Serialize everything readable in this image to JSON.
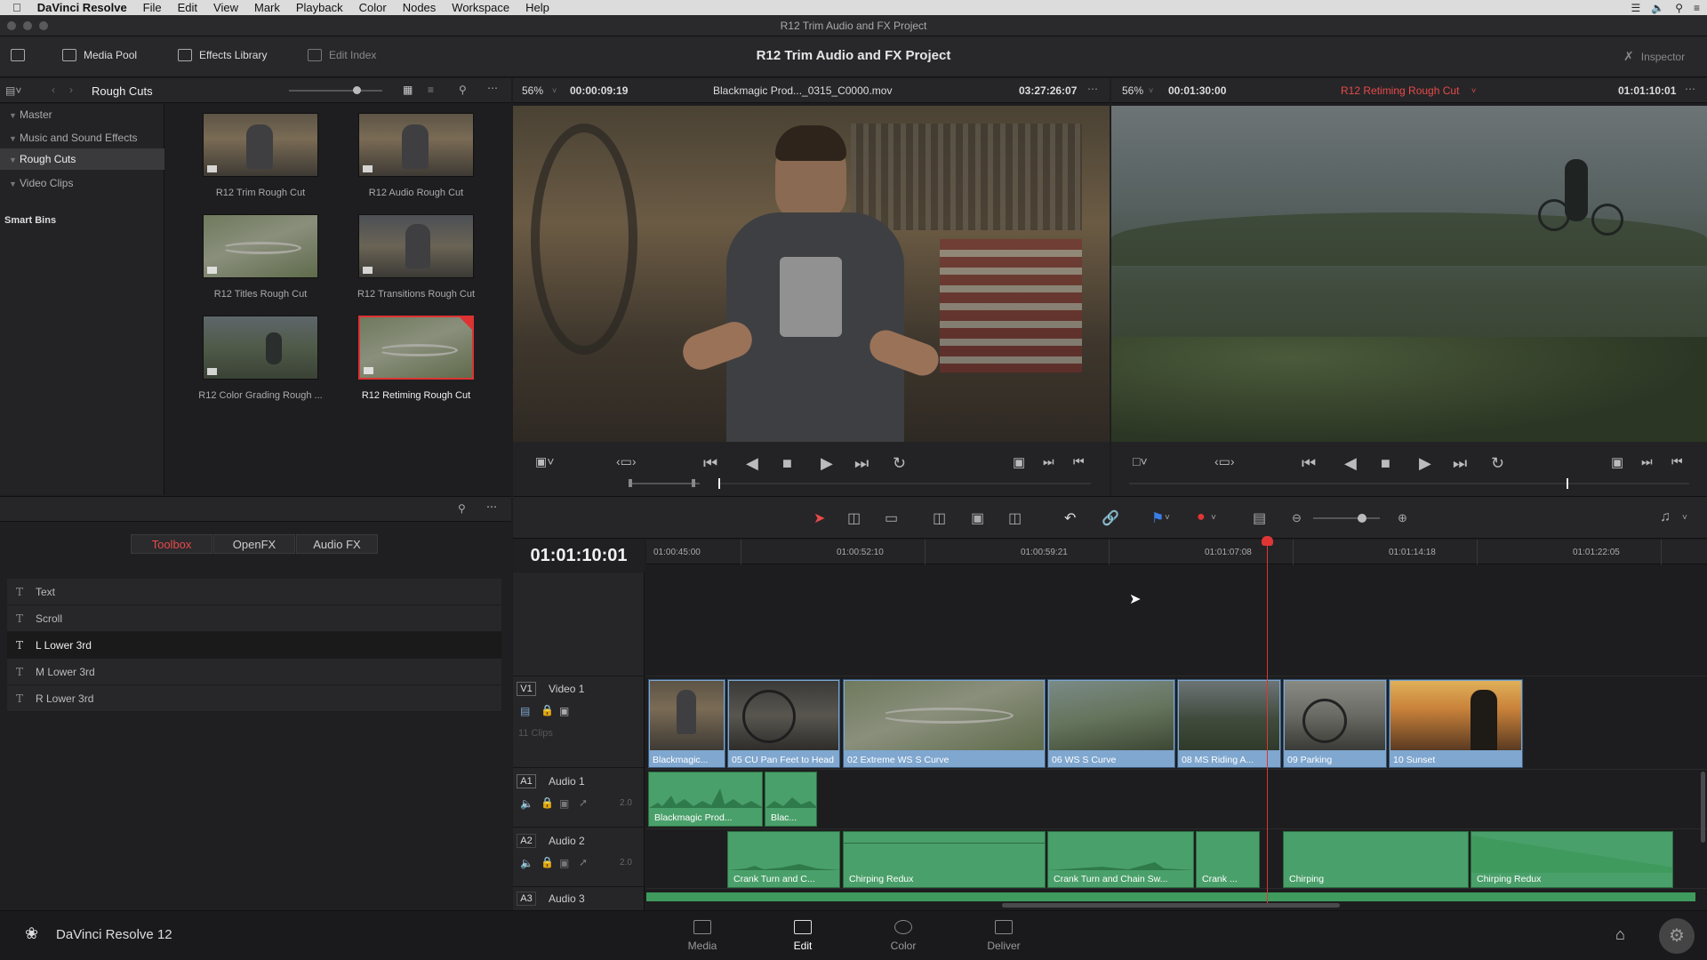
{
  "menubar": {
    "apple": "",
    "app": "DaVinci Resolve",
    "items": [
      "File",
      "Edit",
      "View",
      "Mark",
      "Playback",
      "Color",
      "Nodes",
      "Workspace",
      "Help"
    ]
  },
  "window": {
    "title": "R12 Trim Audio and FX Project"
  },
  "toolbar": {
    "media_pool": "Media Pool",
    "effects_library": "Effects Library",
    "edit_index": "Edit Index",
    "project_title": "R12 Trim Audio and FX Project",
    "inspector": "Inspector"
  },
  "binbar": {
    "current_bin": "Rough Cuts"
  },
  "bins": {
    "items": [
      "Master",
      "Music and Sound Effects",
      "Rough Cuts",
      "Video Clips"
    ],
    "smart_bins": "Smart Bins"
  },
  "thumbs": [
    "R12 Trim Rough Cut",
    "R12 Audio Rough Cut",
    "R12 Titles Rough Cut",
    "R12 Transitions Rough Cut",
    "R12 Color Grading Rough ...",
    "R12 Retiming Rough Cut"
  ],
  "source_viewer": {
    "zoom": "56%",
    "duration": "00:00:09:19",
    "clip": "Blackmagic Prod..._0315_C0000.mov",
    "timecode": "03:27:26:07"
  },
  "timeline_viewer": {
    "zoom": "56%",
    "duration": "00:01:30:00",
    "timeline": "R12 Retiming Rough Cut",
    "timecode": "01:01:10:01"
  },
  "effects": {
    "tabs": [
      "Toolbox",
      "OpenFX",
      "Audio FX"
    ],
    "items": [
      "Text",
      "Scroll",
      "L Lower 3rd",
      "M Lower 3rd",
      "R Lower 3rd"
    ],
    "selected": "L Lower 3rd"
  },
  "timeline": {
    "timecode": "01:01:10:01",
    "ruler": [
      "01:00:45:00",
      "01:00:52:10",
      "01:00:59:21",
      "01:01:07:08",
      "01:01:14:18",
      "01:01:22:05"
    ],
    "tracks": {
      "v1": {
        "tag": "V1",
        "name": "Video 1",
        "clips_count": "11 Clips"
      },
      "a1": {
        "tag": "A1",
        "name": "Audio 1",
        "level": "2.0"
      },
      "a2": {
        "tag": "A2",
        "name": "Audio 2",
        "level": "2.0"
      },
      "a3": {
        "tag": "A3",
        "name": "Audio 3"
      }
    },
    "video_clips": [
      "Blackmagic...",
      "05 CU Pan Feet to Head",
      "02 Extreme WS S Curve",
      "06 WS S Curve",
      "08 MS Riding A...",
      "09 Parking",
      "10 Sunset"
    ],
    "a1_clips": [
      "Blackmagic Prod...",
      "Blac..."
    ],
    "a2_clips": [
      "Crank Turn and C...",
      "Chirping Redux",
      "Crank Turn and Chain Sw...",
      "Crank ...",
      "Chirping",
      "Chirping Redux"
    ]
  },
  "pages": [
    "Media",
    "Edit",
    "Color",
    "Deliver"
  ],
  "selected_page": "Edit",
  "brand": "DaVinci Resolve 12",
  "colors": {
    "accent": "#e84a4a",
    "video_clip": "#7fa7cf",
    "audio_clip": "#4aa06a"
  }
}
